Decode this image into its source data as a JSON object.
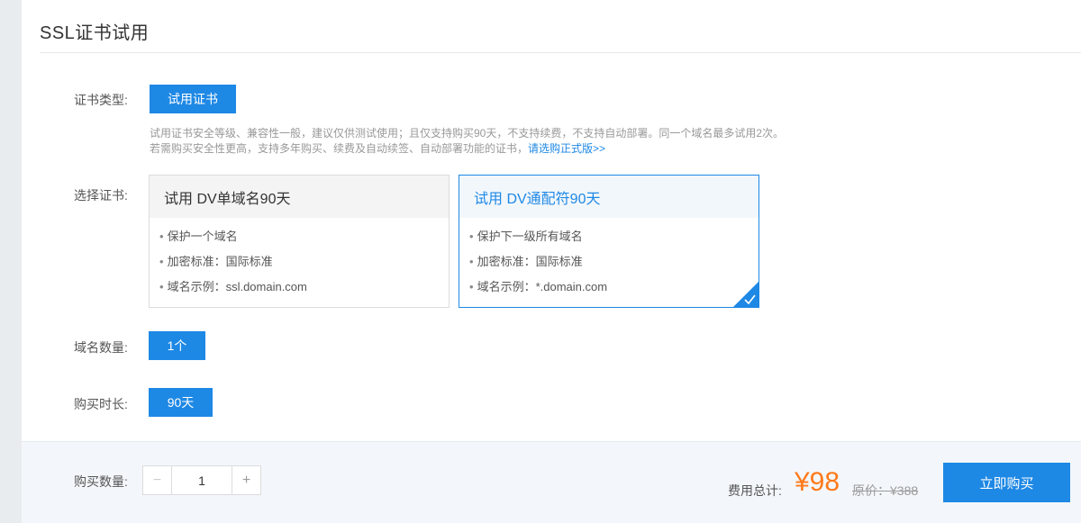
{
  "page_title": "SSL证书试用",
  "cert_type": {
    "label": "证书类型:",
    "button": "试用证书"
  },
  "description": {
    "line1": "试用证书安全等级、兼容性一般，建议仅供测试使用；且仅支持购买90天，不支持续费，不支持自动部署。同一个域名最多试用2次。",
    "line2": "若需购买安全性更高，支持多年购买、续费及自动续签、自动部署功能的证书，",
    "link": "请选购正式版>>"
  },
  "select_cert": {
    "label": "选择证书:",
    "cards": [
      {
        "title": "试用 DV单域名90天",
        "features": [
          "保护一个域名",
          "加密标准：国际标准",
          "域名示例：ssl.domain.com"
        ],
        "selected": false
      },
      {
        "title": "试用 DV通配符90天",
        "features": [
          "保护下一级所有域名",
          "加密标准：国际标准",
          "域名示例：*.domain.com"
        ],
        "selected": true
      }
    ]
  },
  "domain_count": {
    "label": "域名数量:",
    "button": "1个"
  },
  "duration": {
    "label": "购买时长:",
    "button": "90天"
  },
  "footer": {
    "quantity_label": "购买数量:",
    "minus": "−",
    "quantity_value": "1",
    "plus": "+",
    "total_label": "费用总计:",
    "price": "¥98",
    "original_price": "原价：¥388",
    "buy_button": "立即购买"
  },
  "colors": {
    "accent": "#1e88e5",
    "price": "#ff7a1a"
  }
}
